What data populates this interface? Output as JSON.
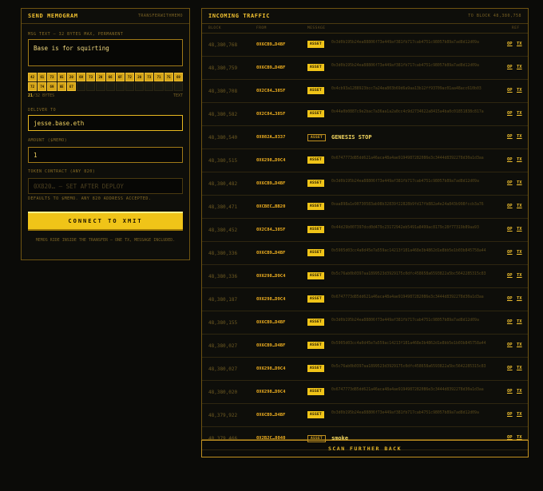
{
  "send": {
    "title": "SEND MEMOGRAM",
    "subtitle": "TRANSFERWITHMEMO",
    "msg_label": "MSG TEXT — 32 BYTES MAX, PERMANENT",
    "msg_value": "Base is for squirting",
    "byte_cells": [
      "42",
      "61",
      "73",
      "65",
      "20",
      "69",
      "73",
      "20",
      "66",
      "6F",
      "72",
      "20",
      "73",
      "71",
      "75",
      "69",
      "72",
      "74",
      "69",
      "6E",
      "67"
    ],
    "byte_capacity": 32,
    "bytes_used": "21",
    "bytes_suffix": "/32 BYTES",
    "bytes_mode": "TEXT",
    "deliver_label": "DELIVER TO",
    "deliver_value": "jesse.base.eth",
    "amount_label": "AMOUNT ($MEMO)",
    "amount_value": "1",
    "token_label": "TOKEN CONTRACT (ANY 820)",
    "token_placeholder": "0X820… — SET AFTER DEPLOY",
    "token_help": "DEFAULTS TO $MEMO. ANY 820 ADDRESS ACCEPTED.",
    "cta_label": "CONNECT TO XMIT",
    "footnote": "MEMOS RIDE INSIDE THE TRANSFER — ONE TX, MESSAGE INCLUDED."
  },
  "traffic": {
    "title": "INCOMING TRAFFIC",
    "subtitle": "TO BLOCK 48,380,758",
    "columns": {
      "block": "BLOCK",
      "from": "FROM",
      "message": "MESSAGE",
      "ref": "REF"
    },
    "op_label": "OP",
    "tx_label": "TX",
    "rows": [
      {
        "block": "48,380,768",
        "from": "0X6CB9…D4BF",
        "badge": "ASSET",
        "kind": "hex",
        "msg": "0x3d0b195b24ea88806f73e449af381fb717cab4751c98057b89a7ad8d12d09a"
      },
      {
        "block": "48,380,759",
        "from": "0X6CB9…D4BF",
        "badge": "ASSET",
        "kind": "hex",
        "msg": "0x3d0b195b24ea88806f73e449af381fb717cab4751c98057b89a7ad8d12d09a"
      },
      {
        "block": "48,380,708",
        "from": "0X2C84…385F",
        "badge": "ASSET",
        "kind": "hex",
        "msg": "0x4cb93a1288923bcc7a24ea803b69d6a9aa13b12ff93709ac01aa48acc610b03"
      },
      {
        "block": "48,380,582",
        "from": "0X2C84…385F",
        "badge": "ASSET",
        "kind": "hex",
        "msg": "0x44a0b0887c9e2bac7a36aa1a2a0cc4c9d2734622a8415a4ba0c01851838c817a"
      },
      {
        "block": "48,380,540",
        "from": "0X082A…8337",
        "badge": "ASSET",
        "kind": "text",
        "msg": "GENESIS STOP"
      },
      {
        "block": "48,380,515",
        "from": "0X6298…D9C4",
        "badge": "ASSET",
        "kind": "hex",
        "msg": "0x6747773d85dd621a46aca48a4ae9194987282086e3c3444d8392278d30a1d3aa"
      },
      {
        "block": "48,380,482",
        "from": "0X6CB9…D4BF",
        "badge": "ASSET",
        "kind": "hex",
        "msg": "0x3d0b195b24ea88806f73e449af381fb717cab4751c98057b89a7ad8d12d09a"
      },
      {
        "block": "48,380,471",
        "from": "0XCBEC…BB20",
        "badge": "ASSET",
        "kind": "hex",
        "msg": "0xaa898a1e90730583ab98b32839f22828b9fd17fb882a4e24a843b998fccb3a76"
      },
      {
        "block": "48,380,452",
        "from": "0X2C84…385F",
        "badge": "ASSET",
        "kind": "hex",
        "msg": "0x44d29b007397dcd0d479c23172942eb5491a8499ac8179c28f77319b89aa93"
      },
      {
        "block": "48,380,336",
        "from": "0X6CB9…D4BF",
        "badge": "ASSET",
        "kind": "hex",
        "msg": "0x5905d03cc4a0d45e7a559ac14213f181a468e3b4862d1e8bb5e1b03b845758a44"
      },
      {
        "block": "48,380,336",
        "from": "0X6298…D9C4",
        "badge": "ASSET",
        "kind": "hex",
        "msg": "0x5c76ab0b0397aa1899523d3929175c0dfc458658a6593822a5bc5642285315c83"
      },
      {
        "block": "48,380,187",
        "from": "0X6298…D9C4",
        "badge": "ASSET",
        "kind": "hex",
        "msg": "0x6747773d85dd621a46aca48a4ae9194987282086e3c3444d8392278d30a1d3aa"
      },
      {
        "block": "48,380,155",
        "from": "0X6CB9…D4BF",
        "badge": "ASSET",
        "kind": "hex",
        "msg": "0x3d0b195b24ea88806f73e449af381fb717cab4751c98057b89a7ad8d12d09a"
      },
      {
        "block": "48,380,027",
        "from": "0X6CB9…D4BF",
        "badge": "ASSET",
        "kind": "hex",
        "msg": "0x5905d03cc4a0d45e7a559ac14213f181a468e3b4862d1e8bb5e1b03b845758a44"
      },
      {
        "block": "48,380,027",
        "from": "0X6298…D9C4",
        "badge": "ASSET",
        "kind": "hex",
        "msg": "0x5c76ab0b0397aa1899523d3929175c0dfc458658a6593822a5bc5642285315c83"
      },
      {
        "block": "48,380,020",
        "from": "0X6298…D9C4",
        "badge": "ASSET",
        "kind": "hex",
        "msg": "0x6747773d85dd621a46aca48a4ae9194987282086e3c3444d8392278d30a1d3aa"
      },
      {
        "block": "48,379,922",
        "from": "0X6CB9…D4BF",
        "badge": "ASSET",
        "kind": "hex",
        "msg": "0x3d0b195b24ea88806f73e449af381fb717cab4751c98057b89a7ad8d12d09a"
      },
      {
        "block": "48,379,466",
        "from": "0X2B2C…8040",
        "badge": "ASSET",
        "kind": "text",
        "msg": "smoke"
      }
    ],
    "scan_label": "SCAN FURTHER BACK"
  }
}
